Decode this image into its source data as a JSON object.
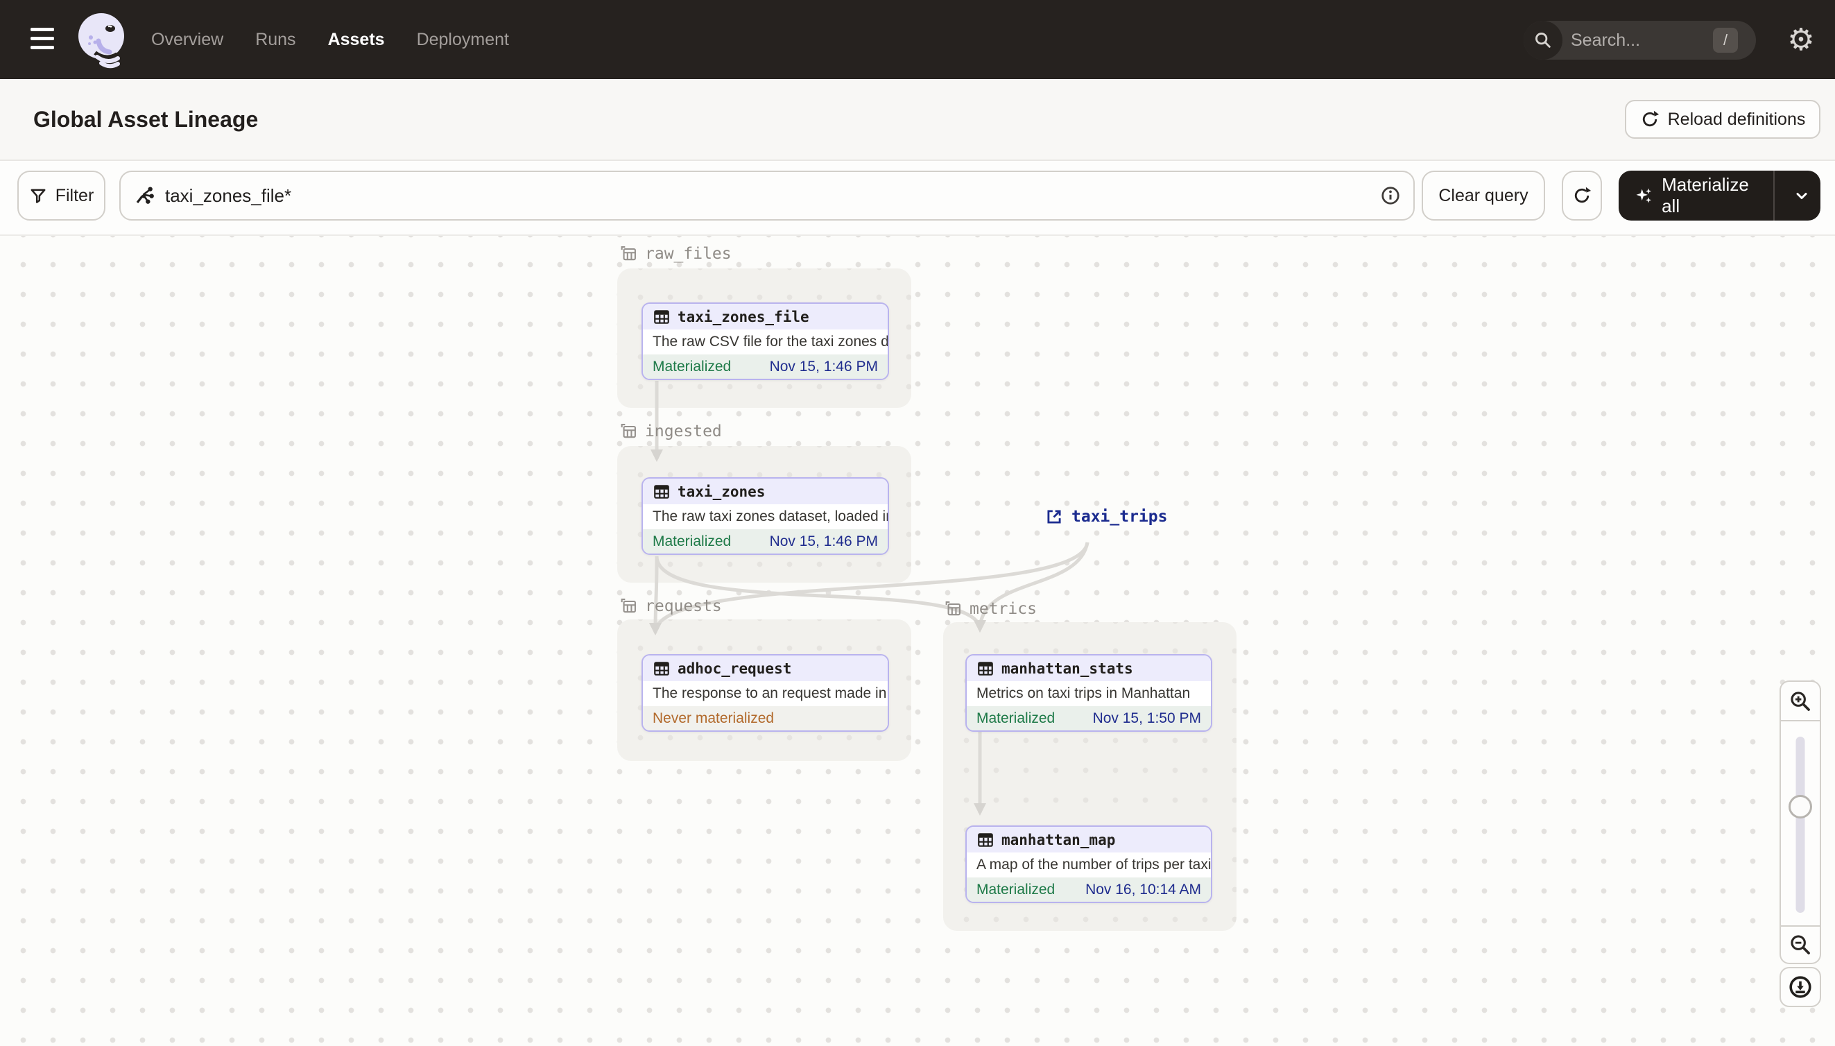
{
  "nav": {
    "links": [
      {
        "label": "Overview"
      },
      {
        "label": "Runs"
      },
      {
        "label": "Assets"
      },
      {
        "label": "Deployment"
      }
    ],
    "active_link": "Assets",
    "search_placeholder": "Search...",
    "search_shortcut": "/"
  },
  "header": {
    "title": "Global Asset Lineage",
    "reload_button_label": "Reload definitions"
  },
  "toolbar": {
    "filter_label": "Filter",
    "query_value": "taxi_zones_file*",
    "clear_button_label": "Clear query",
    "materialize_button_label": "Materialize all"
  },
  "graph": {
    "groups": [
      {
        "name": "raw_files"
      },
      {
        "name": "ingested"
      },
      {
        "name": "requests"
      },
      {
        "name": "metrics"
      }
    ],
    "nodes": [
      {
        "title": "taxi_zones_file",
        "description": "The raw CSV file for the taxi zones dat...",
        "status": "Materialized",
        "timestamp": "Nov 15, 1:46 PM"
      },
      {
        "title": "taxi_zones",
        "description": "The raw taxi zones dataset, loaded int...",
        "status": "Materialized",
        "timestamp": "Nov 15, 1:46 PM"
      },
      {
        "title": "adhoc_request",
        "description": "The response to an request made in th...",
        "status": "Never materialized",
        "timestamp": ""
      },
      {
        "title": "manhattan_stats",
        "description": "Metrics on taxi trips in Manhattan",
        "status": "Materialized",
        "timestamp": "Nov 15, 1:50 PM"
      },
      {
        "title": "manhattan_map",
        "description": "A map of the number of trips per taxi z...",
        "status": "Materialized",
        "timestamp": "Nov 16, 10:14 AM"
      }
    ],
    "external_asset": {
      "label": "taxi_trips"
    }
  },
  "colors": {
    "nav_bg": "#26221f",
    "node_border_purple": "#b9b3ee",
    "node_header_lavender": "#edecfc",
    "materialized_green": "#1e7a48",
    "timestamp_blue": "#1f2c8e",
    "never_materialized_orange": "#b26a2c",
    "edge_gray": "#dcdad6",
    "canvas_bg": "#fcfcfa",
    "group_bg": "#f2f1ed"
  }
}
